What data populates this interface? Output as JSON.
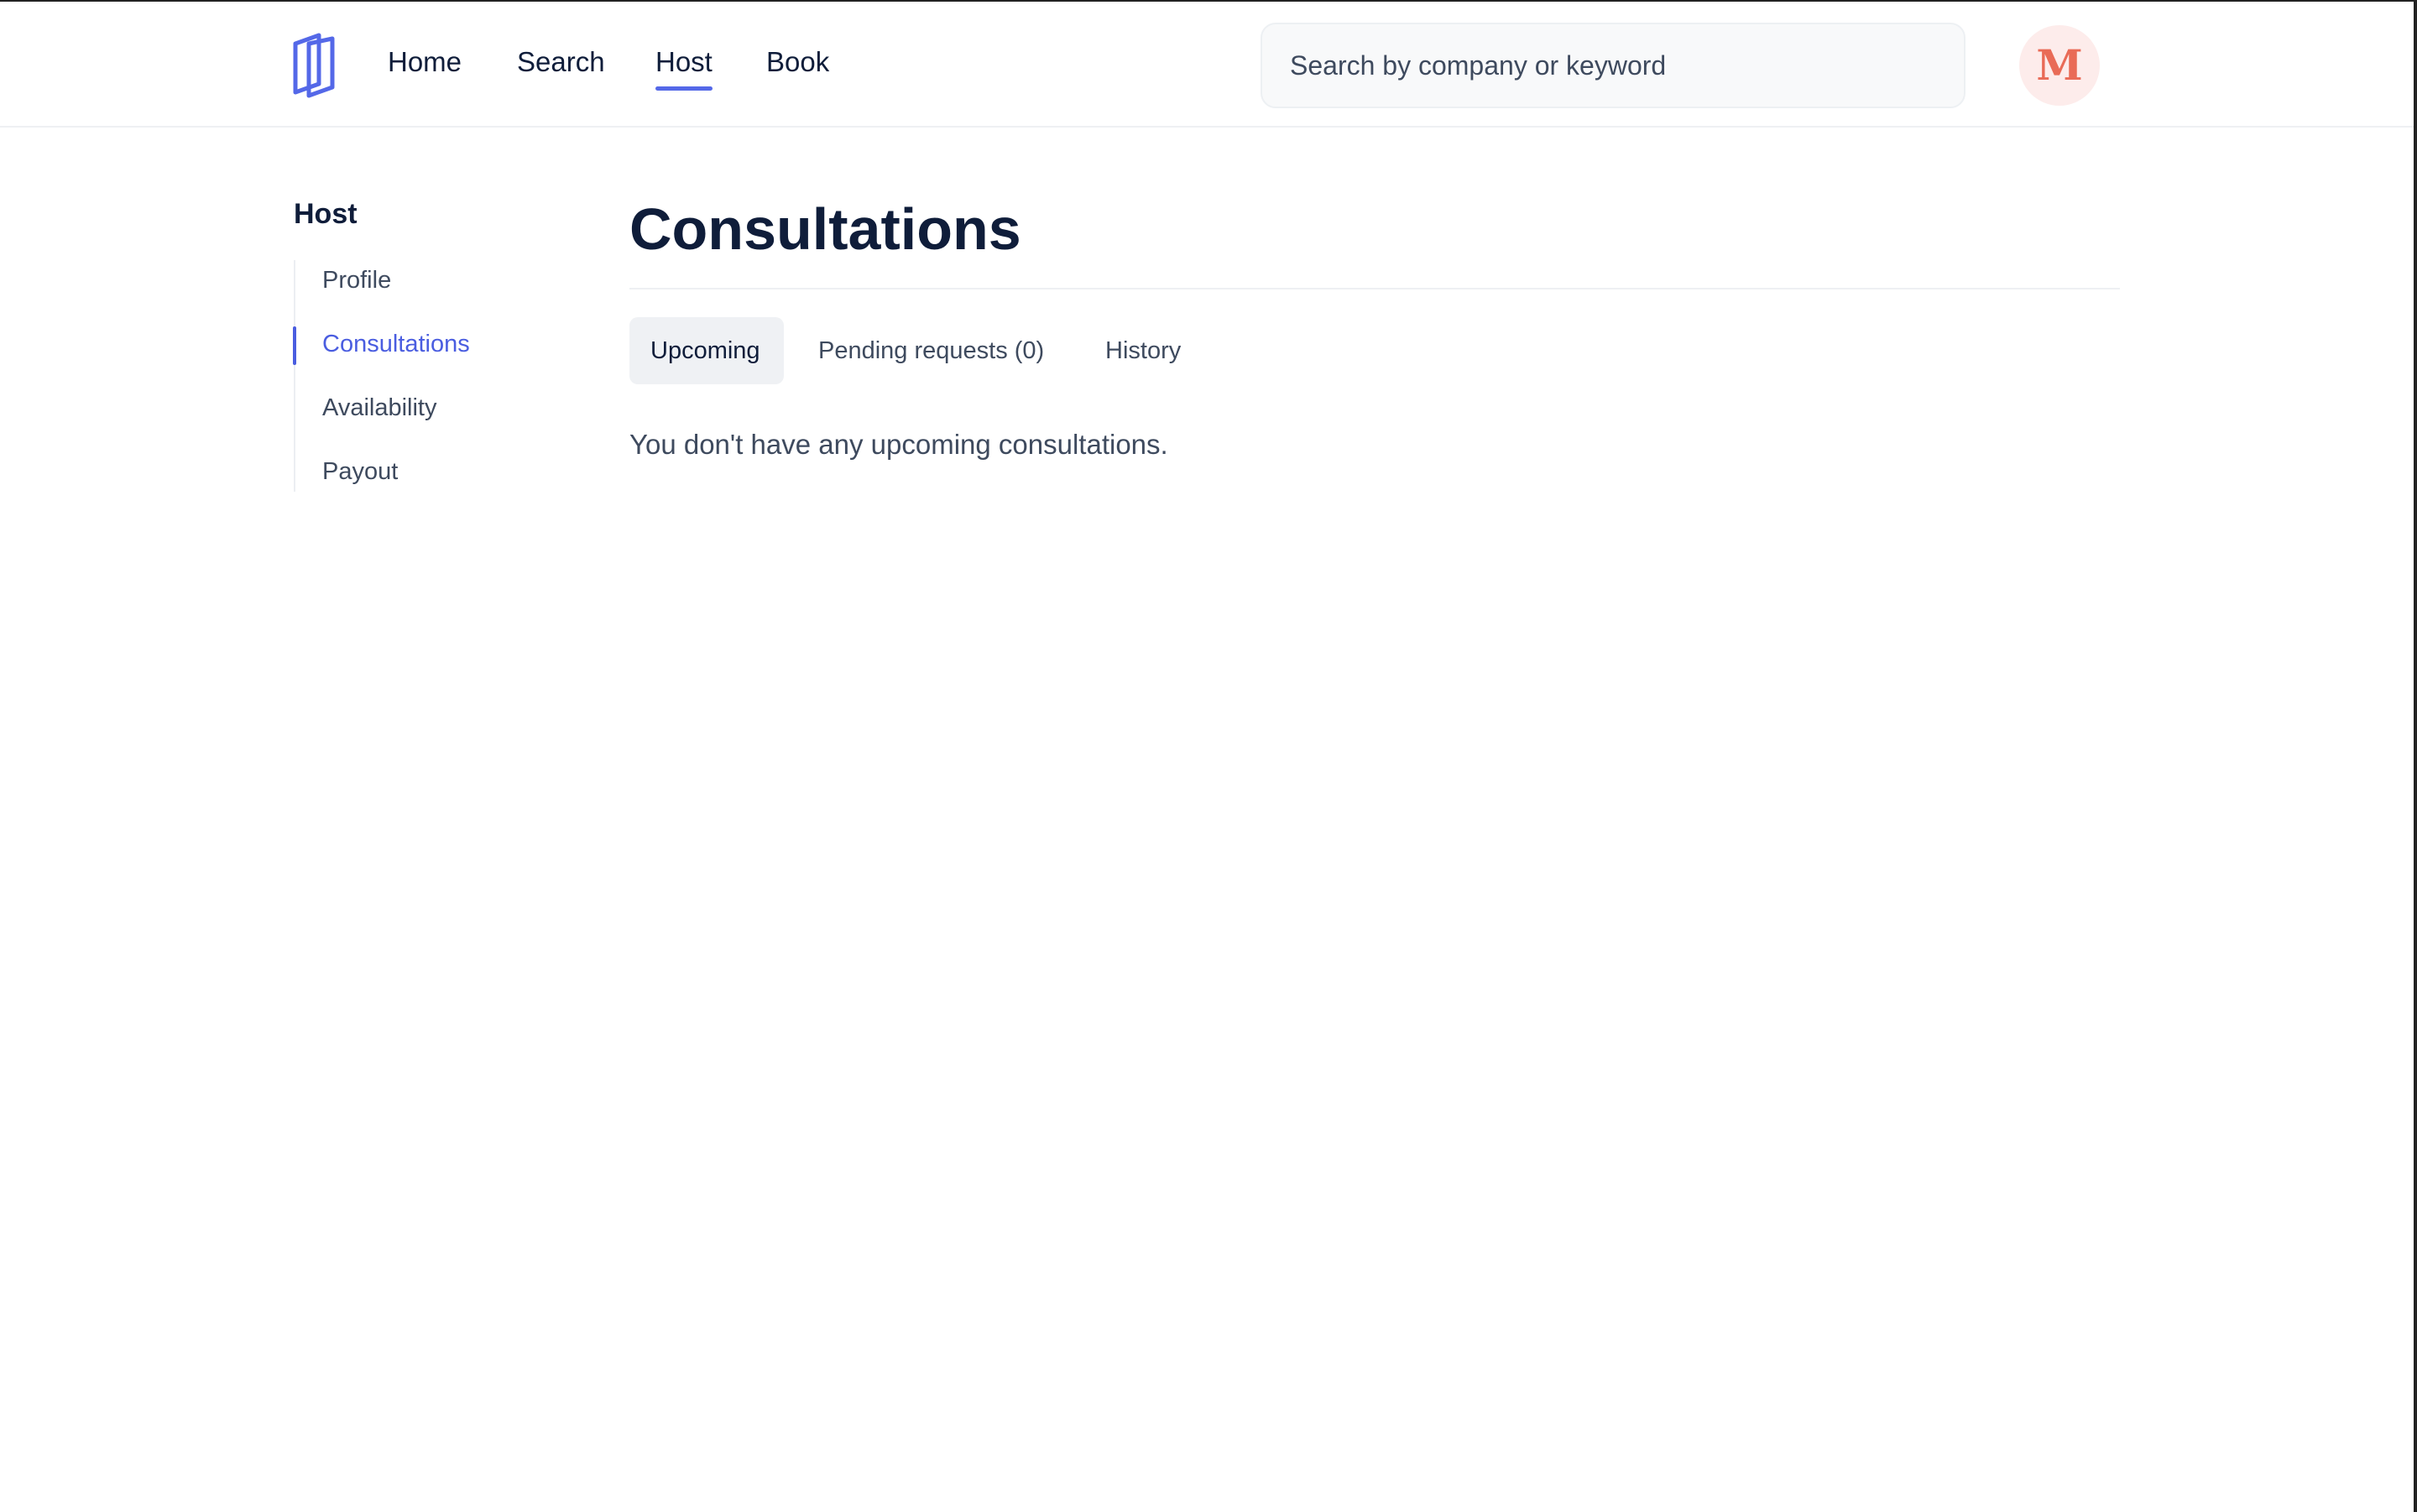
{
  "header": {
    "logo_icon": "book-logo-icon",
    "nav": [
      {
        "label": "Home"
      },
      {
        "label": "Search"
      },
      {
        "label": "Host",
        "active": true
      },
      {
        "label": "Book"
      }
    ],
    "search": {
      "placeholder": "Search by company or keyword",
      "value": ""
    },
    "avatar": {
      "initial": "M",
      "color": "#e96b57",
      "background": "#fdeceb"
    }
  },
  "sidebar": {
    "title": "Host",
    "items": [
      {
        "label": "Profile"
      },
      {
        "label": "Consultations",
        "active": true
      },
      {
        "label": "Availability"
      },
      {
        "label": "Payout"
      }
    ]
  },
  "main": {
    "title": "Consultations",
    "tabs": [
      {
        "label": "Upcoming",
        "active": true
      },
      {
        "label": "Pending requests (0)"
      },
      {
        "label": "History"
      }
    ],
    "empty_message": "You don't have any upcoming consultations."
  },
  "colors": {
    "accent": "#4a5de0",
    "text_primary": "#0f1d3a",
    "text_secondary": "#3e4a5e"
  }
}
